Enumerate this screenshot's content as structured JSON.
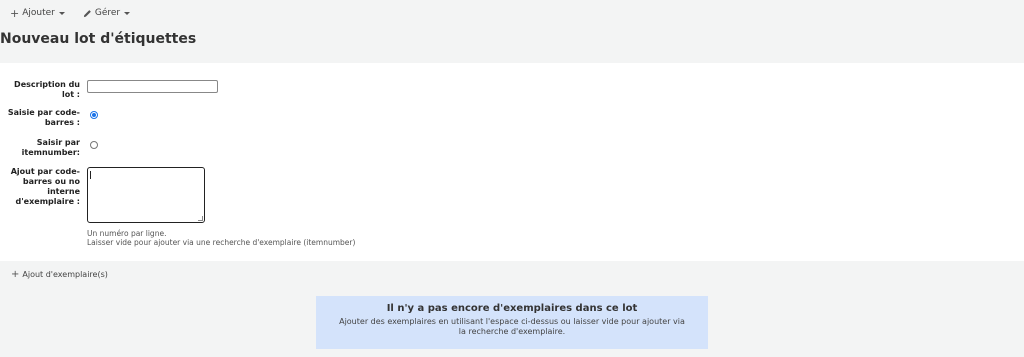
{
  "toolbar": {
    "add_label": "Ajouter",
    "manage_label": "Gérer"
  },
  "page": {
    "title": "Nouveau lot d'étiquettes"
  },
  "form": {
    "description_label": "Description du lot :",
    "description_value": "",
    "barcode_entry_label": "Saisie par code-barres :",
    "barcode_entry_selected": true,
    "itemnumber_entry_label": "Saisir par itemnumber:",
    "itemnumber_entry_selected": false,
    "add_items_label": "Ajout par code-barres ou no interne d'exemplaire :",
    "add_items_value": "",
    "hint_line1": "Un numéro par ligne.",
    "hint_line2": "Laisser vide pour ajouter via une recherche d'exemplaire (itemnumber)"
  },
  "actions": {
    "add_items_button": "Ajout d'exemplaire(s)"
  },
  "alert": {
    "title": "Il n'y a pas encore d'exemplaires dans ce lot",
    "text": "Ajouter des exemplaires en utilisant l'espace ci-dessus ou laisser vide pour ajouter via la recherche d'exemplaire.",
    "background": "#d4e3fb"
  },
  "colors": {
    "accent": "#1a73e8",
    "page_background": "#f3f4f4"
  }
}
